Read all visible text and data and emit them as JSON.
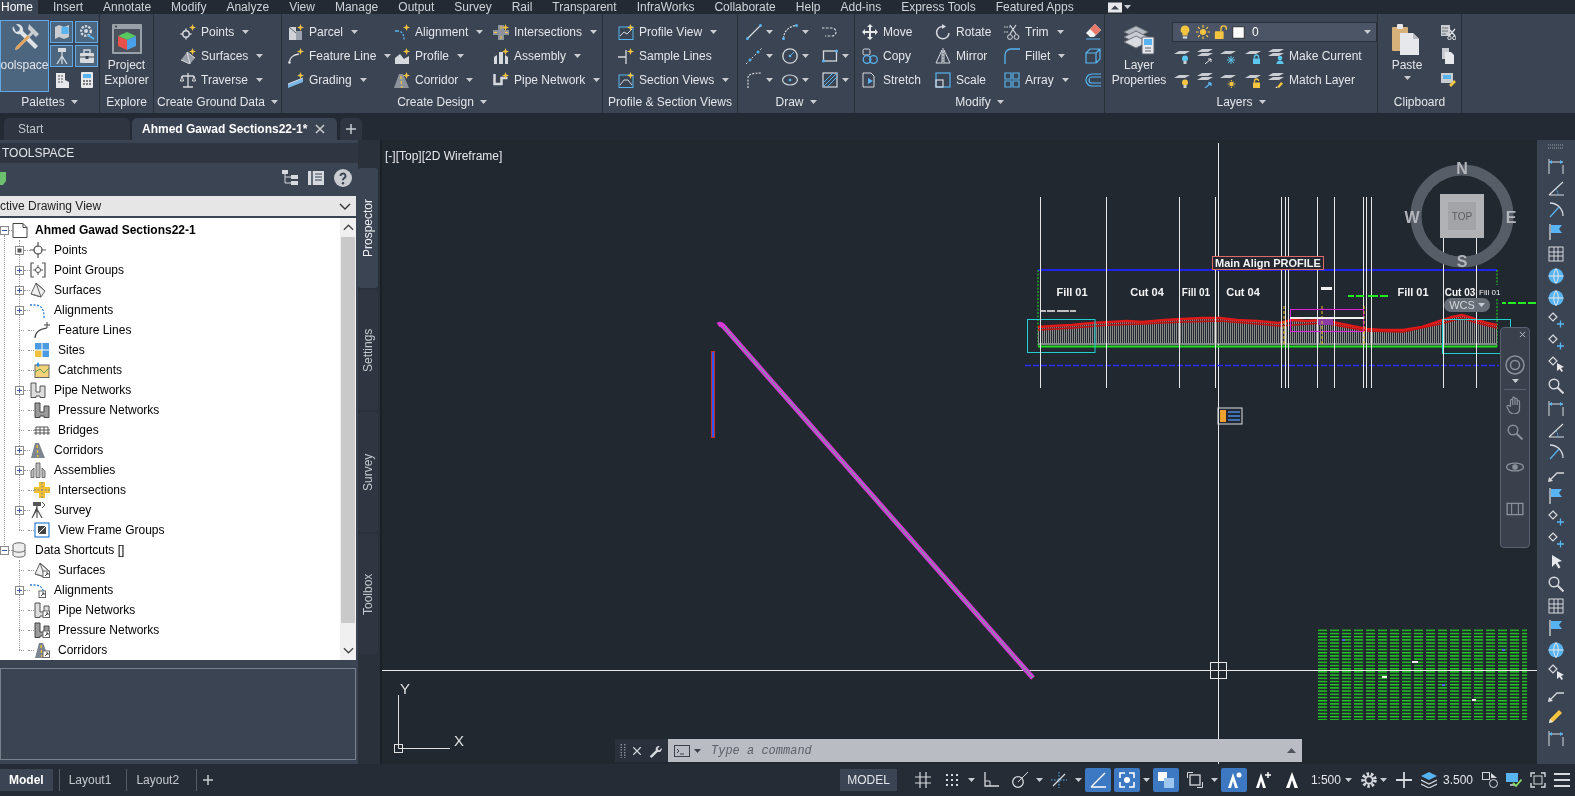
{
  "menu_tabs": [
    {
      "label": "Home",
      "selected": true
    },
    {
      "label": "Insert",
      "selected": false
    },
    {
      "label": "Annotate",
      "selected": false
    },
    {
      "label": "Modify",
      "selected": false
    },
    {
      "label": "Analyze",
      "selected": false
    },
    {
      "label": "View",
      "selected": false
    },
    {
      "label": "Manage",
      "selected": false
    },
    {
      "label": "Output",
      "selected": false
    },
    {
      "label": "Survey",
      "selected": false
    },
    {
      "label": "Rail",
      "selected": false
    },
    {
      "label": "Transparent",
      "selected": false
    },
    {
      "label": "InfraWorks",
      "selected": false
    },
    {
      "label": "Collaborate",
      "selected": false
    },
    {
      "label": "Help",
      "selected": false
    },
    {
      "label": "Add-ins",
      "selected": false
    },
    {
      "label": "Express Tools",
      "selected": false
    },
    {
      "label": "Featured Apps",
      "selected": false
    }
  ],
  "ribbon": [
    {
      "title": "Palettes",
      "dropdown": true,
      "large": [
        {
          "label": "oolspace",
          "on": true
        }
      ],
      "columns": [
        [
          {
            "on": true
          },
          {
            "on": true
          },
          {
            "on": false
          }
        ],
        [
          {
            "on": true
          },
          {
            "on": true
          },
          {
            "on": false
          }
        ]
      ]
    },
    {
      "title": "Explore",
      "dropdown": false,
      "large": [
        {
          "label": "Project Explorer",
          "on": false
        }
      ]
    },
    {
      "title": "Create Ground Data",
      "dropdown": true,
      "columns": [
        [
          {
            "label": "Points",
            "dropdown": true
          },
          {
            "label": "Surfaces",
            "dropdown": true
          },
          {
            "label": "Traverse",
            "dropdown": true
          }
        ]
      ]
    },
    {
      "title": "Create Design",
      "dropdown": true,
      "columns": [
        [
          {
            "label": "Parcel",
            "dropdown": true
          },
          {
            "label": "Feature Line",
            "dropdown": true
          },
          {
            "label": "Grading",
            "dropdown": true
          }
        ],
        [
          {
            "label": "Alignment",
            "dropdown": true
          },
          {
            "label": "Profile",
            "dropdown": true
          },
          {
            "label": "Corridor",
            "dropdown": true
          }
        ],
        [
          {
            "label": "Intersections",
            "dropdown": true
          },
          {
            "label": "Assembly",
            "dropdown": true
          },
          {
            "label": "Pipe Network",
            "dropdown": true
          }
        ]
      ]
    },
    {
      "title": "Profile & Section Views",
      "dropdown": false,
      "columns": [
        [
          {
            "label": "Profile View",
            "dropdown": true
          },
          {
            "label": "Sample Lines",
            "dropdown": false
          },
          {
            "label": "Section Views",
            "dropdown": true
          }
        ]
      ]
    },
    {
      "title": "Draw",
      "dropdown": true,
      "columns": [
        [
          {
            "dropdown": true
          },
          {
            "dropdown": true
          },
          {
            "dropdown": true
          }
        ],
        [
          {
            "dropdown": true
          },
          {
            "dropdown": true
          },
          {
            "dropdown": true
          }
        ],
        [
          {
            "dropdown": false
          },
          {
            "dropdown": true
          },
          {
            "dropdown": true
          }
        ]
      ]
    },
    {
      "title": "Modify",
      "dropdown": true,
      "columns": [
        [
          {
            "label": "Move",
            "dropdown": false
          },
          {
            "label": "Copy",
            "dropdown": false
          },
          {
            "label": "Stretch",
            "dropdown": false
          }
        ],
        [
          {
            "label": "Rotate",
            "dropdown": false
          },
          {
            "label": "Mirror",
            "dropdown": false
          },
          {
            "label": "Scale",
            "dropdown": false
          }
        ],
        [
          {
            "label": "Trim",
            "dropdown": true
          },
          {
            "label": "Fillet",
            "dropdown": true
          },
          {
            "label": "Array",
            "dropdown": true
          }
        ],
        [
          {
            "dropdown": false
          },
          {
            "dropdown": false
          },
          {
            "dropdown": false
          }
        ]
      ]
    },
    {
      "title": "Layers",
      "dropdown": true,
      "large": [
        {
          "label": "Layer Properties",
          "on": false
        }
      ],
      "layer": {
        "value": "0"
      },
      "columns": [
        [
          {
            "dropdown": false
          },
          {
            "dropdown": false
          }
        ],
        [
          {
            "dropdown": false
          },
          {
            "dropdown": false
          }
        ],
        [
          {
            "dropdown": false
          },
          {
            "dropdown": false
          }
        ],
        [
          {
            "dropdown": false
          },
          {
            "dropdown": false
          }
        ],
        [
          {
            "label": "Make Current",
            "dropdown": false
          },
          {
            "label": "Match Layer",
            "dropdown": false
          }
        ]
      ]
    },
    {
      "title": "Clipboard",
      "dropdown": false,
      "large": [
        {
          "label": "Paste",
          "on": false,
          "dropdown": true
        }
      ],
      "columns": [
        [
          {
            "dropdown": false
          },
          {
            "dropdown": false
          },
          {
            "dropdown": false
          }
        ]
      ]
    }
  ],
  "document_tabs": [
    {
      "label": "Start",
      "selected": false
    },
    {
      "label": "Ahmed Gawad Sections22-1*",
      "selected": true
    }
  ],
  "toolspace": {
    "title": "TOOLSPACE",
    "view": "ctive Drawing View",
    "tree": [
      {
        "label": "Ahmed Gawad Sections22-1",
        "current": true,
        "expanded": true,
        "children": [
          {
            "label": "Points",
            "expanded": false,
            "pending": true
          },
          {
            "label": "Point Groups",
            "expanded": false
          },
          {
            "label": "Surfaces",
            "expanded": false
          },
          {
            "label": "Alignments",
            "expanded": false
          },
          {
            "label": "Feature Lines"
          },
          {
            "label": "Sites"
          },
          {
            "label": "Catchments"
          },
          {
            "label": "Pipe Networks",
            "expanded": false
          },
          {
            "label": "Pressure Networks"
          },
          {
            "label": "Bridges"
          },
          {
            "label": "Corridors",
            "expanded": false
          },
          {
            "label": "Assemblies",
            "expanded": false
          },
          {
            "label": "Intersections"
          },
          {
            "label": "Survey",
            "expanded": false
          },
          {
            "label": "View Frame Groups"
          }
        ]
      },
      {
        "label": "Data Shortcuts []",
        "current": false,
        "expanded": true,
        "children": [
          {
            "label": "Surfaces"
          },
          {
            "label": "Alignments",
            "expanded": false
          },
          {
            "label": "Pipe Networks"
          },
          {
            "label": "Pressure Networks"
          },
          {
            "label": "Corridors"
          }
        ]
      }
    ],
    "tabs": [
      {
        "label": "Prospector",
        "selected": true
      },
      {
        "label": "Settings",
        "selected": false
      },
      {
        "label": "Survey",
        "selected": false
      },
      {
        "label": "Toolbox",
        "selected": false
      }
    ]
  },
  "viewport": {
    "controls": [
      "[-]",
      "[Top]",
      "[2D Wireframe]"
    ]
  },
  "viewcube": {
    "north": "N",
    "south": "S",
    "east": "E",
    "west": "W",
    "face": "TOP",
    "ucs_menu": "WCS"
  },
  "profile": {
    "title": "Main Align PROFILE",
    "sections": [
      "Fill 01",
      "Cut 04",
      "Fill 01",
      "Cut 04",
      "Fill 01",
      "Cut 03",
      "Fill 01"
    ]
  },
  "ucs_icon": {
    "x": "X",
    "y": "Y"
  },
  "command_line": {
    "placeholder": "Type a command"
  },
  "status_bar": {
    "layout_tabs": [
      {
        "label": "Model",
        "selected": true
      },
      {
        "label": "Layout1",
        "selected": false
      },
      {
        "label": "Layout2",
        "selected": false
      }
    ],
    "space": "MODEL",
    "toggles": [
      {
        "on": false,
        "dropdown": false
      },
      {
        "on": false,
        "dropdown": true
      },
      {
        "on": false,
        "dropdown": false
      },
      {
        "on": false,
        "dropdown": true
      },
      {
        "on": false,
        "dropdown": true
      },
      {
        "on": true,
        "dropdown": false
      },
      {
        "on": true,
        "dropdown": true
      },
      {
        "on": true,
        "dropdown": false
      },
      {
        "on": false,
        "dropdown": true
      },
      {
        "on": true,
        "dropdown": false
      },
      {
        "on": false,
        "dropdown": false
      },
      {
        "on": false,
        "dropdown": false
      }
    ],
    "scale": "1:500",
    "readout": "3.500"
  }
}
